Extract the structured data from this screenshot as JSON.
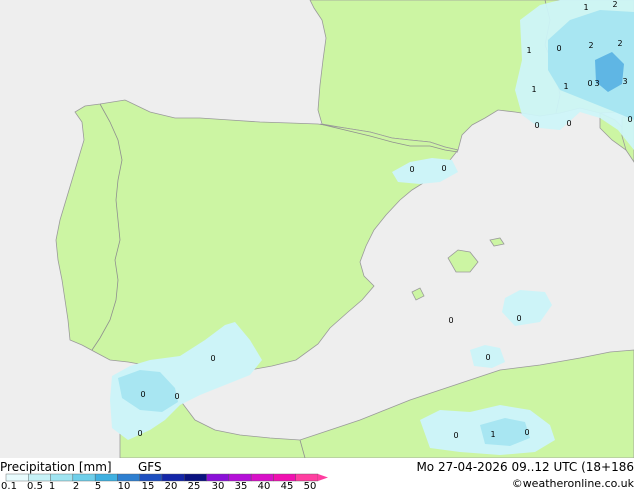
{
  "map": {
    "colors": {
      "sea": "#eeeeee",
      "land": "#ccf5a3",
      "border": "#888888",
      "precip_light": "#cdf4f8",
      "precip_mid": "#a8e6f2",
      "precip_heavy": "#5fb6e4"
    },
    "point_labels": [
      {
        "text": "1"
      },
      {
        "text": "2"
      },
      {
        "text": "2"
      },
      {
        "text": "2"
      },
      {
        "text": "1"
      },
      {
        "text": "1"
      },
      {
        "text": "3"
      },
      {
        "text": "3"
      },
      {
        "text": "1"
      },
      {
        "text": "0"
      },
      {
        "text": "0"
      },
      {
        "text": "0"
      },
      {
        "text": "0"
      },
      {
        "text": "0"
      },
      {
        "text": "0"
      },
      {
        "text": "0"
      },
      {
        "text": "0"
      },
      {
        "text": "0"
      },
      {
        "text": "0"
      },
      {
        "text": "0"
      },
      {
        "text": "0"
      },
      {
        "text": "0"
      },
      {
        "text": "0"
      },
      {
        "text": "1"
      },
      {
        "text": "0"
      },
      {
        "text": "0"
      }
    ]
  },
  "footer": {
    "title": "Precipitation [mm]",
    "model": "GFS",
    "datetime": "Mo 27-04-2026 09..12 UTC (18+186",
    "credit": "©weatheronline.co.uk",
    "legend": {
      "ticks": [
        "0.1",
        "0.5",
        "1",
        "2",
        "5",
        "10",
        "15",
        "20",
        "25",
        "30",
        "35",
        "40",
        "45",
        "50"
      ],
      "colors": [
        "#e8fbfd",
        "#c6f2f7",
        "#9fe4f1",
        "#6fcfea",
        "#3fb0e0",
        "#2e7fd0",
        "#1e4fc0",
        "#1426a8",
        "#0a1280",
        "#8a10d8",
        "#b410d8",
        "#d810c8",
        "#f010b0",
        "#ff3ea0"
      ]
    }
  }
}
